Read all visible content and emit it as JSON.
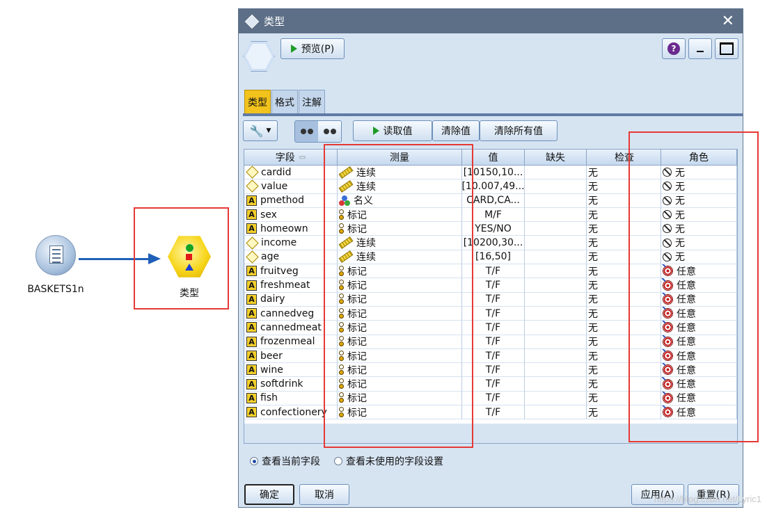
{
  "canvas": {
    "source_node_label": "BASKETS1n",
    "type_node_label": "类型"
  },
  "dialog": {
    "title": "类型",
    "preview_label": "预览(P)",
    "tabs": [
      "类型",
      "格式",
      "注解"
    ],
    "read_values_label": "读取值",
    "clear_values_label": "清除值",
    "clear_all_values_label": "清除所有值",
    "columns": [
      "字段",
      "测量",
      "值",
      "缺失",
      "检查",
      "角色"
    ],
    "rows": [
      {
        "field": "cardid",
        "field_icon": "continuous-diamond-icon",
        "measure": "连续",
        "measure_icon": "ruler-icon",
        "values": "[10150,10...",
        "missing": "",
        "check": "无",
        "role": "无",
        "role_icon": "none-icon"
      },
      {
        "field": "value",
        "field_icon": "real-diamond-icon",
        "measure": "连续",
        "measure_icon": "ruler-icon",
        "values": "[10.007,49...",
        "missing": "",
        "check": "无",
        "role": "无",
        "role_icon": "none-icon"
      },
      {
        "field": "pmethod",
        "field_icon": "string-A-icon",
        "measure": "名义",
        "measure_icon": "nominal-icon",
        "values": "CARD,CA...",
        "missing": "",
        "check": "无",
        "role": "无",
        "role_icon": "none-icon"
      },
      {
        "field": "sex",
        "field_icon": "string-A-icon",
        "measure": "标记",
        "measure_icon": "flag-icon",
        "values": "M/F",
        "missing": "",
        "check": "无",
        "role": "无",
        "role_icon": "none-icon"
      },
      {
        "field": "homeown",
        "field_icon": "string-A-icon",
        "measure": "标记",
        "measure_icon": "flag-icon",
        "values": "YES/NO",
        "missing": "",
        "check": "无",
        "role": "无",
        "role_icon": "none-icon"
      },
      {
        "field": "income",
        "field_icon": "continuous-diamond-icon",
        "measure": "连续",
        "measure_icon": "ruler-icon",
        "values": "[10200,30...",
        "missing": "",
        "check": "无",
        "role": "无",
        "role_icon": "none-icon"
      },
      {
        "field": "age",
        "field_icon": "continuous-diamond-icon",
        "measure": "连续",
        "measure_icon": "ruler-icon",
        "values": "[16,50]",
        "missing": "",
        "check": "无",
        "role": "无",
        "role_icon": "none-icon"
      },
      {
        "field": "fruitveg",
        "field_icon": "string-A-icon",
        "measure": "标记",
        "measure_icon": "flag-icon",
        "values": "T/F",
        "missing": "",
        "check": "无",
        "role": "任意",
        "role_icon": "target-icon"
      },
      {
        "field": "freshmeat",
        "field_icon": "string-A-icon",
        "measure": "标记",
        "measure_icon": "flag-icon",
        "values": "T/F",
        "missing": "",
        "check": "无",
        "role": "任意",
        "role_icon": "target-icon"
      },
      {
        "field": "dairy",
        "field_icon": "string-A-icon",
        "measure": "标记",
        "measure_icon": "flag-icon",
        "values": "T/F",
        "missing": "",
        "check": "无",
        "role": "任意",
        "role_icon": "target-icon"
      },
      {
        "field": "cannedveg",
        "field_icon": "string-A-icon",
        "measure": "标记",
        "measure_icon": "flag-icon",
        "values": "T/F",
        "missing": "",
        "check": "无",
        "role": "任意",
        "role_icon": "target-icon"
      },
      {
        "field": "cannedmeat",
        "field_icon": "string-A-icon",
        "measure": "标记",
        "measure_icon": "flag-icon",
        "values": "T/F",
        "missing": "",
        "check": "无",
        "role": "任意",
        "role_icon": "target-icon"
      },
      {
        "field": "frozenmeal",
        "field_icon": "string-A-icon",
        "measure": "标记",
        "measure_icon": "flag-icon",
        "values": "T/F",
        "missing": "",
        "check": "无",
        "role": "任意",
        "role_icon": "target-icon"
      },
      {
        "field": "beer",
        "field_icon": "string-A-icon",
        "measure": "标记",
        "measure_icon": "flag-icon",
        "values": "T/F",
        "missing": "",
        "check": "无",
        "role": "任意",
        "role_icon": "target-icon"
      },
      {
        "field": "wine",
        "field_icon": "string-A-icon",
        "measure": "标记",
        "measure_icon": "flag-icon",
        "values": "T/F",
        "missing": "",
        "check": "无",
        "role": "任意",
        "role_icon": "target-icon"
      },
      {
        "field": "softdrink",
        "field_icon": "string-A-icon",
        "measure": "标记",
        "measure_icon": "flag-icon",
        "values": "T/F",
        "missing": "",
        "check": "无",
        "role": "任意",
        "role_icon": "target-icon"
      },
      {
        "field": "fish",
        "field_icon": "string-A-icon",
        "measure": "标记",
        "measure_icon": "flag-icon",
        "values": "T/F",
        "missing": "",
        "check": "无",
        "role": "任意",
        "role_icon": "target-icon"
      },
      {
        "field": "confectionery",
        "field_icon": "string-A-icon",
        "measure": "标记",
        "measure_icon": "flag-icon",
        "values": "T/F",
        "missing": "",
        "check": "无",
        "role": "任意",
        "role_icon": "target-icon"
      }
    ],
    "view_current_label": "查看当前字段",
    "view_unused_label": "查看未使用的字段设置",
    "view_selected": "view_current",
    "ok_label": "确定",
    "cancel_label": "取消",
    "apply_label": "应用(A)",
    "reset_label": "重置(R)"
  },
  "watermark": "https://blog.csdn.net/Lyric1",
  "colors": {
    "highlight_box": "#e53935",
    "active_tab": "#f2c31c",
    "titlebar": "#5d6f86",
    "arrow": "#1f5fb8"
  }
}
